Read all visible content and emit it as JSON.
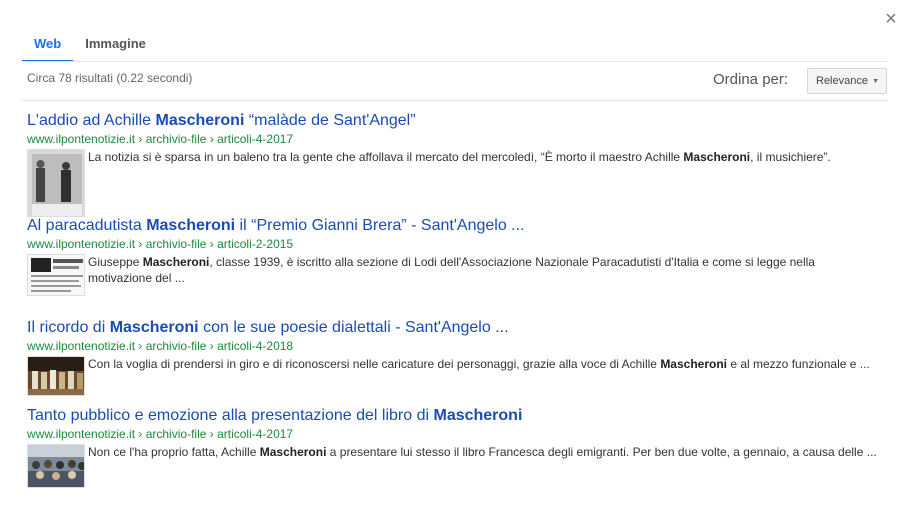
{
  "close_icon": "×",
  "tabs": [
    {
      "label": "Web",
      "active": true
    },
    {
      "label": "Immagine",
      "active": false
    }
  ],
  "stats": "Circa 78 risultati (0.22 secondi)",
  "sort": {
    "label": "Ordina per:",
    "value": "Relevance"
  },
  "results": [
    {
      "title": [
        {
          "t": "L'addio ad Achille ",
          "b": false
        },
        {
          "t": "Mascheroni",
          "b": true
        },
        {
          "t": " “malàde de Sant'Angel”",
          "b": false
        }
      ],
      "url": "www.ilpontenotizie.it › archivio-file › articoli-4-2017",
      "snippet": [
        {
          "t": "La notizia si è sparsa in un baleno tra la gente che affollava il mercato del mercoledì, “È morto il maestro Achille ",
          "b": false
        },
        {
          "t": "Mascheroni",
          "b": true
        },
        {
          "t": ", il musichiere”.",
          "b": false
        }
      ],
      "thumb": "photo-bw"
    },
    {
      "title": [
        {
          "t": "Al paracadutista ",
          "b": false
        },
        {
          "t": "Mascheroni",
          "b": true
        },
        {
          "t": " il “Premio Gianni Brera” - Sant'Angelo ...",
          "b": false
        }
      ],
      "url": "www.ilpontenotizie.it › archivio-file › articoli-2-2015",
      "snippet": [
        {
          "t": "Giuseppe ",
          "b": false
        },
        {
          "t": "Mascheroni",
          "b": true
        },
        {
          "t": ", classe 1939, è iscritto alla sezione di Lodi dell'Associazione Nazionale Paracadutisti d'Italia e come si legge nella motivazione del ...",
          "b": false
        }
      ],
      "thumb": "document"
    },
    {
      "title": [
        {
          "t": "Il ricordo di ",
          "b": false
        },
        {
          "t": "Mascheroni",
          "b": true
        },
        {
          "t": " con le sue poesie dialettali - Sant'Angelo ...",
          "b": false
        }
      ],
      "url": "www.ilpontenotizie.it › archivio-file › articoli-4-2018",
      "snippet": [
        {
          "t": "Con la voglia di prendersi in giro e di riconoscersi nelle caricature dei personaggi, grazie alla voce di Achille ",
          "b": false
        },
        {
          "t": "Mascheroni",
          "b": true
        },
        {
          "t": " e al mezzo funzionale e ...",
          "b": false
        }
      ],
      "thumb": "stage"
    },
    {
      "title": [
        {
          "t": "Tanto pubblico e emozione alla presentazione del libro di ",
          "b": false
        },
        {
          "t": "Mascheroni",
          "b": true
        }
      ],
      "url": "www.ilpontenotizie.it › archivio-file › articoli-4-2017",
      "snippet": [
        {
          "t": "Non ce l'ha proprio fatta, Achille ",
          "b": false
        },
        {
          "t": "Mascheroni",
          "b": true
        },
        {
          "t": " a presentare lui stesso il libro Francesca degli emigranti. Per ben due volte, a gennaio, a causa delle ...",
          "b": false
        }
      ],
      "thumb": "audience"
    }
  ]
}
